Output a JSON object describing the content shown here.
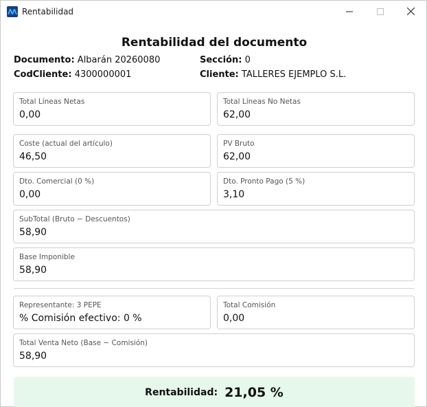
{
  "window": {
    "title": "Rentabilidad",
    "minimize": "—",
    "maximize": "☐",
    "close": "✕"
  },
  "header": {
    "title": "Rentabilidad del documento",
    "documento_label": "Documento:",
    "documento_value": "Albarán 20260080",
    "seccion_label": "Sección:",
    "seccion_value": "0",
    "codcliente_label": "CodCliente:",
    "codcliente_value": "4300000001",
    "cliente_label": "Cliente:",
    "cliente_value": "TALLERES EJEMPLO S.L."
  },
  "fields": {
    "total_lineas_netas": {
      "label": "Total Líneas Netas",
      "value": "0,00"
    },
    "total_lineas_no_netas": {
      "label": "Total Líneas No Netas",
      "value": "62,00"
    },
    "coste": {
      "label": "Coste (actual del artículo)",
      "value": "46,50"
    },
    "pv_bruto": {
      "label": "PV Bruto",
      "value": "62,00"
    },
    "dto_comercial": {
      "label": "Dto. Comercial (0 %)",
      "value": "0,00"
    },
    "dto_pronto_pago": {
      "label": "Dto. Pronto Pago (5 %)",
      "value": "3,10"
    },
    "subtotal": {
      "label": "SubTotal (Bruto − Descuentos)",
      "value": "58,90"
    },
    "base_imponible": {
      "label": "Base Imponible",
      "value": "58,90"
    },
    "representante": {
      "label": "Representante: 3 PEPE",
      "value": "% Comisión efectivo: 0 %"
    },
    "total_comision": {
      "label": "Total Comisión",
      "value": "0,00"
    },
    "total_venta_neto": {
      "label": "Total Venta Neto (Base − Comisión)",
      "value": "58,90"
    }
  },
  "result": {
    "label": "Rentabilidad:",
    "value": "21,05 %"
  },
  "colors": {
    "result_bg": "#e6f8ec",
    "border": "#cfcfcf"
  }
}
